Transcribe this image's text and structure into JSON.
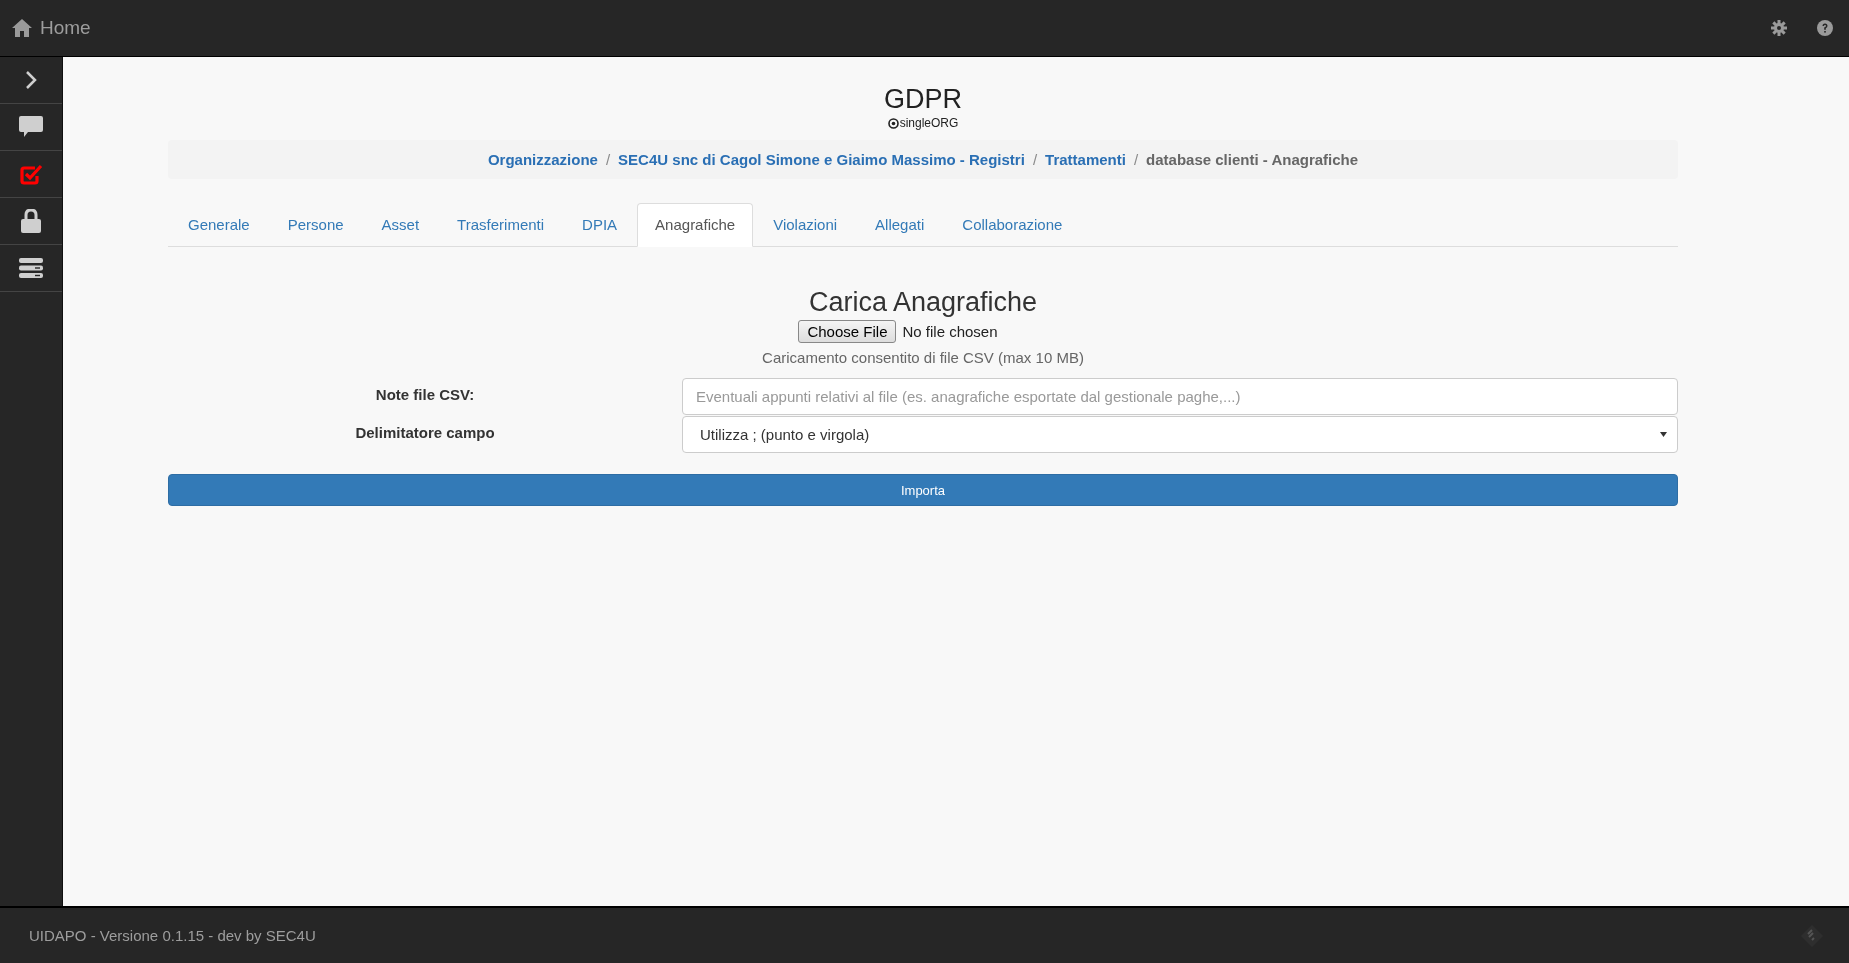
{
  "header": {
    "title": "Home"
  },
  "sidebar": {
    "items": [
      {
        "kind": "chevron",
        "selected": false
      },
      {
        "kind": "chat",
        "selected": false
      },
      {
        "kind": "check",
        "selected": true
      },
      {
        "kind": "lock",
        "selected": false
      },
      {
        "kind": "server",
        "selected": false
      }
    ]
  },
  "page": {
    "title": "GDPR",
    "subtitle": "singleORG"
  },
  "breadcrumb_separator": "/",
  "breadcrumb": [
    {
      "label": "Organizzazione",
      "link": true
    },
    {
      "label": "SEC4U snc di Cagol Simone e Giaimo Massimo - Registri",
      "link": true
    },
    {
      "label": "Trattamenti",
      "link": true
    },
    {
      "label": "database clienti - Anagrafiche",
      "link": false
    }
  ],
  "tabs": [
    {
      "label": "Generale",
      "selected": false
    },
    {
      "label": "Persone",
      "selected": false
    },
    {
      "label": "Asset",
      "selected": false
    },
    {
      "label": "Trasferimenti",
      "selected": false
    },
    {
      "label": "DPIA",
      "selected": false
    },
    {
      "label": "Anagrafiche",
      "selected": true
    },
    {
      "label": "Violazioni",
      "selected": false
    },
    {
      "label": "Allegati",
      "selected": false
    },
    {
      "label": "Collaborazione",
      "selected": false
    }
  ],
  "upload": {
    "title": "Carica Anagrafiche",
    "button": "Choose File",
    "status": "No file chosen",
    "note": "Caricamento consentito di file CSV (max 10 MB)"
  },
  "form": [
    {
      "kind": "text",
      "label": "Note file CSV:",
      "placeholder": "Eventuali appunti relativi al file (es. anagrafiche esportate dal gestionale paghe,...)"
    },
    {
      "kind": "select",
      "label": "Delimitatore campo",
      "value": "Utilizza ; (punto e virgola)"
    }
  ],
  "submit": "Importa",
  "footer": "UIDAPO - Versione 0.1.15 - dev by SEC4U"
}
